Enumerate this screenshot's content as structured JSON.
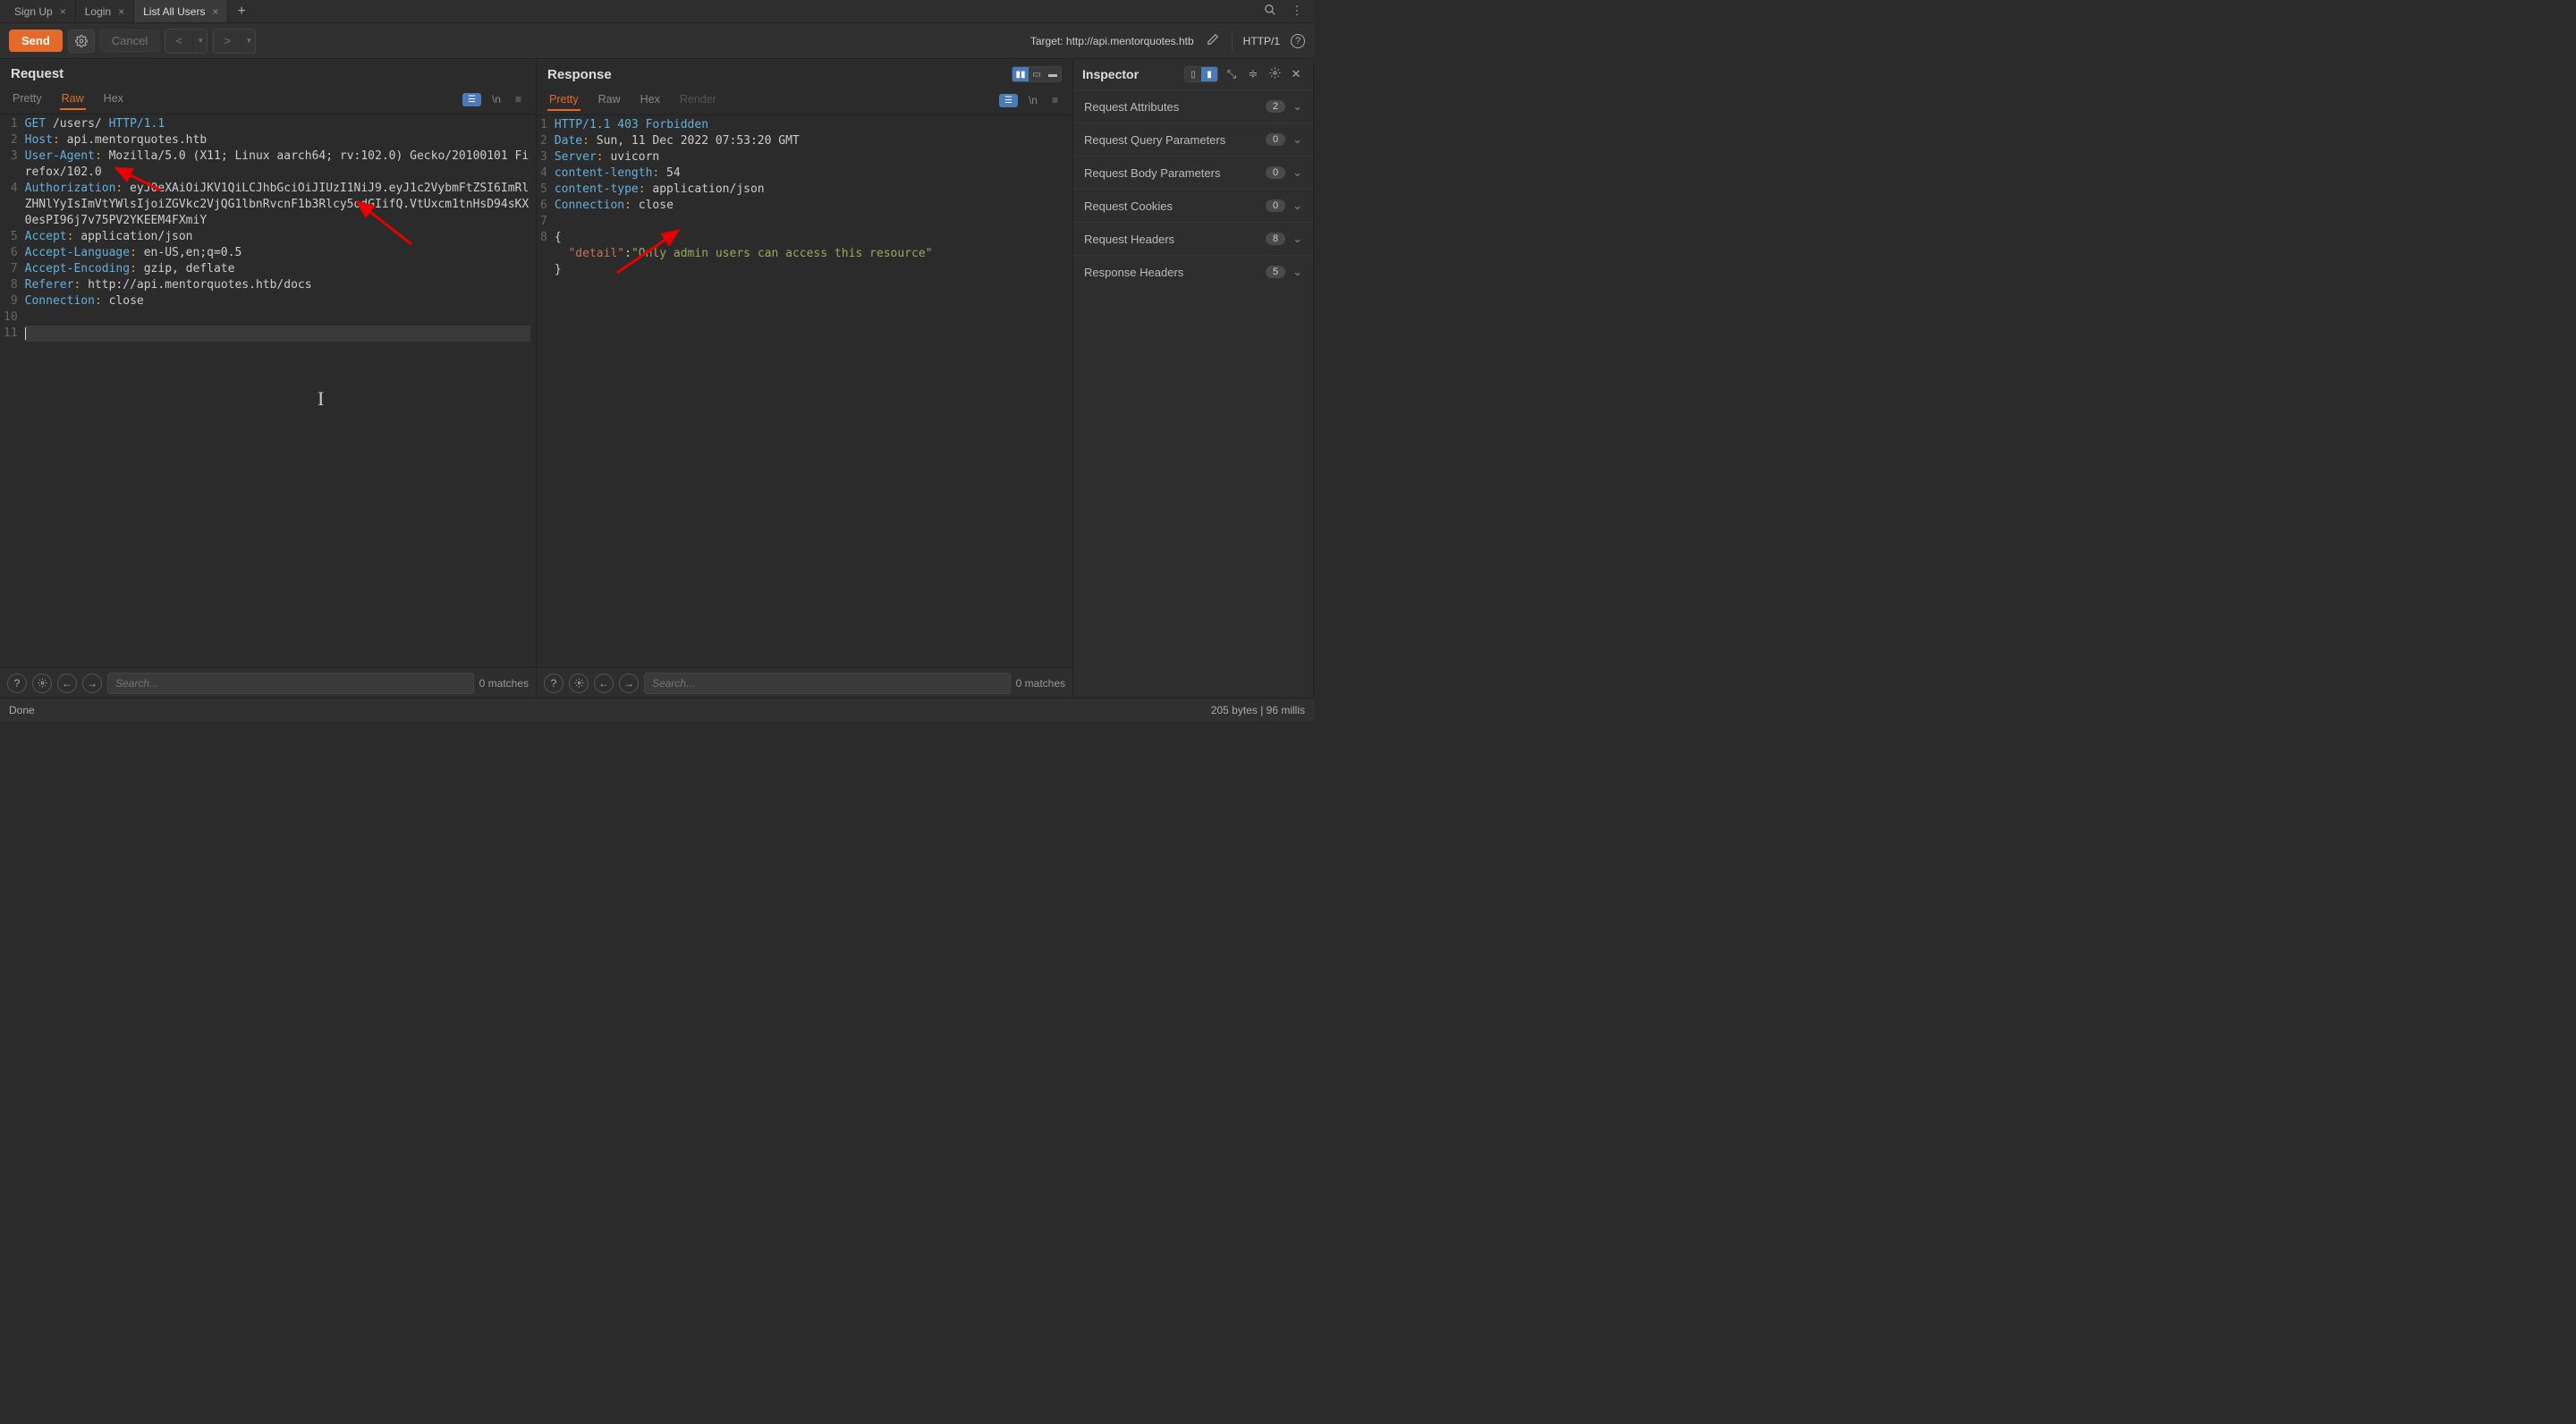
{
  "tabs": [
    {
      "label": "Sign Up",
      "active": false
    },
    {
      "label": "Login",
      "active": false
    },
    {
      "label": "List All Users",
      "active": true
    }
  ],
  "toolbar": {
    "send": "Send",
    "cancel": "Cancel",
    "target_label": "Target: http://api.mentorquotes.htb",
    "protocol": "HTTP/1"
  },
  "request": {
    "title": "Request",
    "tabs": {
      "pretty": "Pretty",
      "raw": "Raw",
      "hex": "Hex"
    },
    "active_tab": "raw",
    "lines": [
      "GET /users/ HTTP/1.1",
      "Host: api.mentorquotes.htb",
      "User-Agent: Mozilla/5.0 (X11; Linux aarch64; rv:102.0) Gecko/20100101 Firefox/102.0",
      "Authorization: eyJ0eXAiOiJKV1QiLCJhbGciOiJIUzI1NiJ9.eyJ1c2VybmFtZSI6ImRlZHNlYyIsImVtYWlsIjoiZGVkc2VjQG1lbnRvcnF1b3Rlcy5odGIifQ.VtUxcm1tnHsD94sKX0esPI96j7v75PV2YKEEM4FXmiY",
      "Accept: application/json",
      "Accept-Language: en-US,en;q=0.5",
      "Accept-Encoding: gzip, deflate",
      "Referer: http://api.mentorquotes.htb/docs",
      "Connection: close",
      "",
      ""
    ],
    "search_placeholder": "Search...",
    "matches": "0 matches"
  },
  "response": {
    "title": "Response",
    "tabs": {
      "pretty": "Pretty",
      "raw": "Raw",
      "hex": "Hex",
      "render": "Render"
    },
    "active_tab": "pretty",
    "status_line": "HTTP/1.1 403 Forbidden",
    "headers": [
      [
        "Date",
        "Sun, 11 Dec 2022 07:53:20 GMT"
      ],
      [
        "Server",
        "uvicorn"
      ],
      [
        "content-length",
        "54"
      ],
      [
        "content-type",
        "application/json"
      ],
      [
        "Connection",
        "close"
      ]
    ],
    "body_key": "\"detail\"",
    "body_val": "\"Only admin users can access this resource\"",
    "search_placeholder": "Search...",
    "matches": "0 matches"
  },
  "inspector": {
    "title": "Inspector",
    "rows": [
      {
        "label": "Request Attributes",
        "count": "2"
      },
      {
        "label": "Request Query Parameters",
        "count": "0"
      },
      {
        "label": "Request Body Parameters",
        "count": "0"
      },
      {
        "label": "Request Cookies",
        "count": "0"
      },
      {
        "label": "Request Headers",
        "count": "8"
      },
      {
        "label": "Response Headers",
        "count": "5"
      }
    ]
  },
  "status": {
    "left": "Done",
    "right": "205 bytes | 96 millis"
  }
}
